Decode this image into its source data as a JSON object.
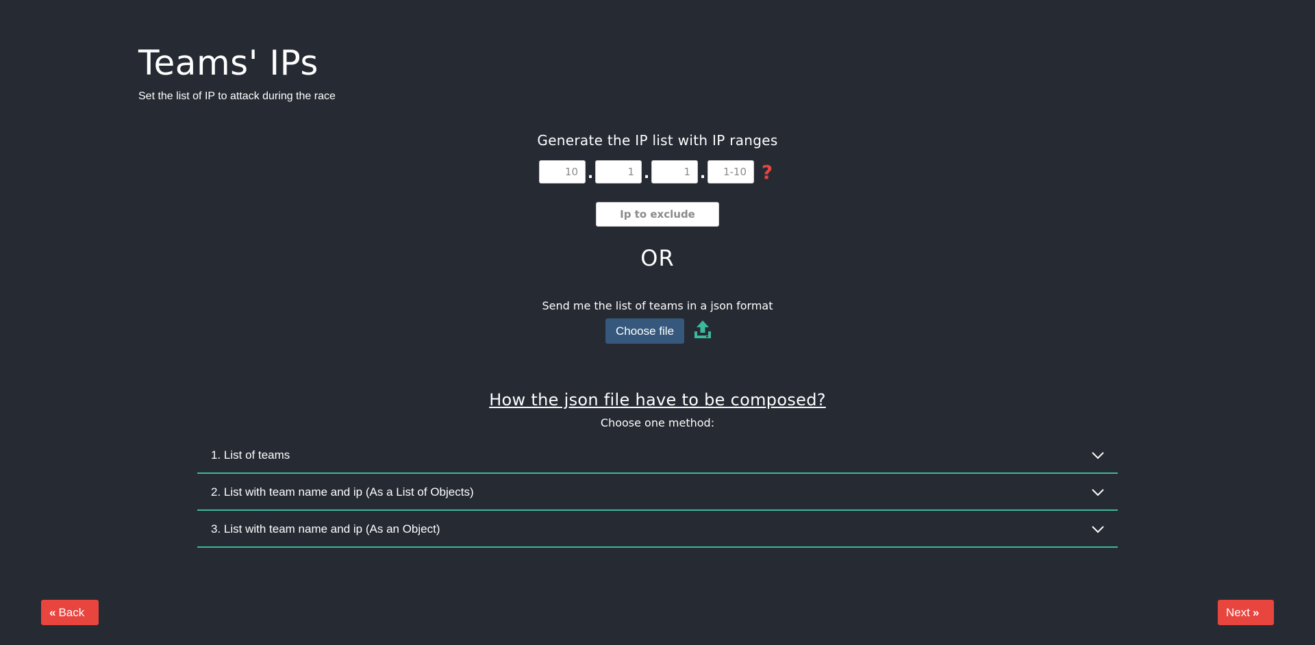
{
  "header": {
    "title": "Teams' IPs",
    "subtitle": "Set the list of IP to attack during the race"
  },
  "generator": {
    "title": "Generate the IP list with IP ranges",
    "octets": [
      {
        "placeholder": "10"
      },
      {
        "placeholder": "1"
      },
      {
        "placeholder": "1"
      },
      {
        "placeholder": "1-10"
      }
    ],
    "separator": ".",
    "help_icon": "question-mark-icon",
    "help_glyph": "?",
    "exclude_placeholder": "Ip to exclude"
  },
  "or_text": "OR",
  "upload": {
    "label": "Send me the list of teams in a json format",
    "choose_file_label": "Choose file",
    "icon": "upload-icon"
  },
  "json_help": {
    "title": "How the json file have to be composed?",
    "subtitle": "Choose one method:",
    "methods": [
      {
        "label": "1. List of teams"
      },
      {
        "label": "2. List with team name and ip (As a List of Objects)"
      },
      {
        "label": "3. List with team name and ip (As an Object)"
      }
    ]
  },
  "navigation": {
    "back_label": "Back",
    "next_label": "Next",
    "back_icon": "double-chevron-left-icon",
    "next_icon": "double-chevron-right-icon"
  },
  "colors": {
    "background": "#262a33",
    "accent_red": "#e9453f",
    "accent_teal": "#3db89e",
    "button_blue": "#35587c"
  }
}
